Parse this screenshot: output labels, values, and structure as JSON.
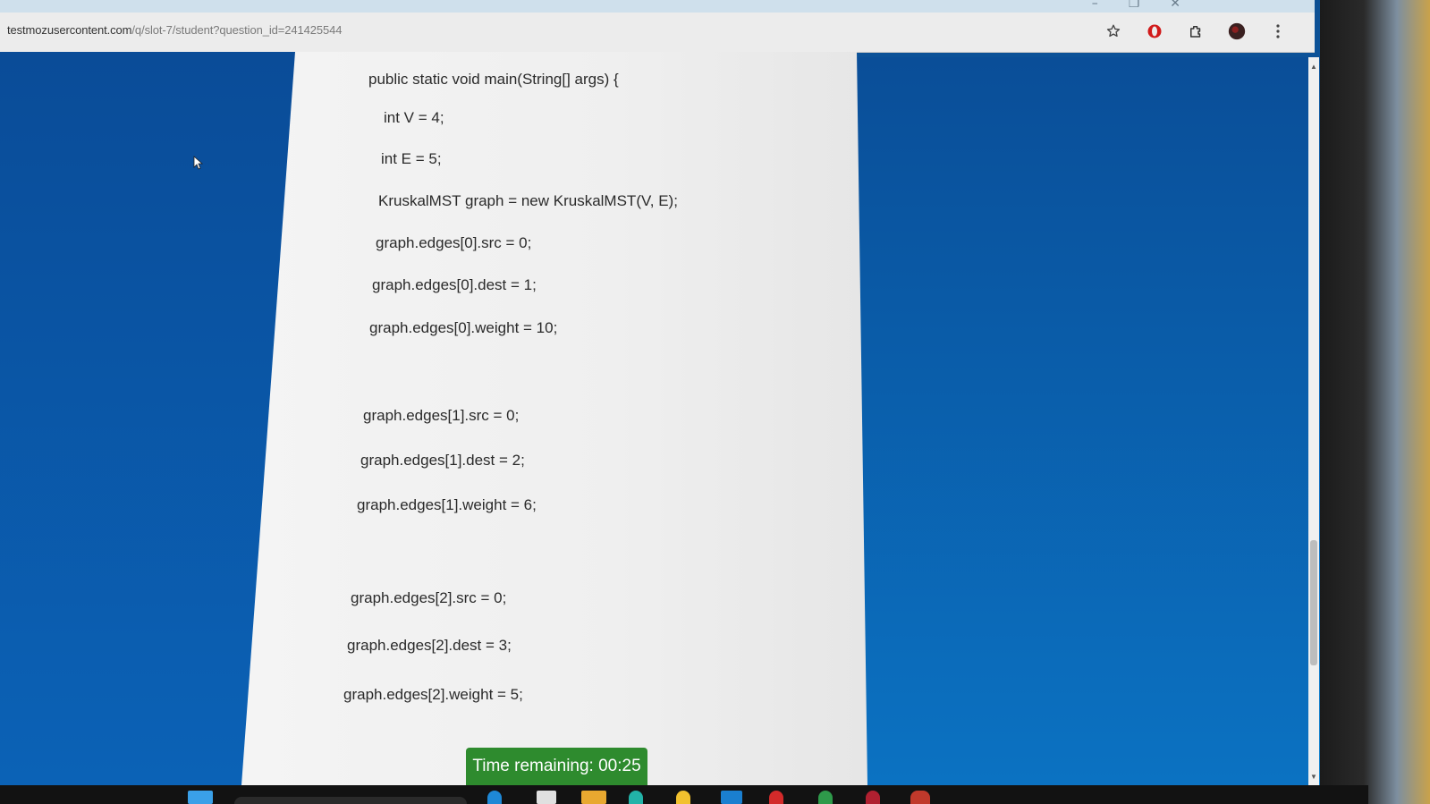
{
  "browser": {
    "url_host": "testmozusercontent.com",
    "url_path": "/q/slot-7/student?question_id=241425544",
    "icons": [
      "bookmark-star-icon",
      "opera-icon",
      "extensions-icon",
      "profile-avatar-icon",
      "menu-kebab-icon"
    ]
  },
  "code": {
    "lines": [
      "public static void main(String[] args) {",
      "int V = 4;",
      "int E = 5;",
      "KruskalMST graph = new KruskalMST(V, E);",
      "graph.edges[0].src = 0;",
      "graph.edges[0].dest = 1;",
      "graph.edges[0].weight = 10;",
      "graph.edges[1].src = 0;",
      "graph.edges[1].dest = 2;",
      "graph.edges[1].weight = 6;",
      "graph.edges[2].src = 0;",
      "graph.edges[2].dest = 3;",
      "graph.edges[2].weight = 5;"
    ]
  },
  "timer": {
    "label": "Time remaining: 00:25"
  },
  "colors": {
    "side_panel": "#0b62b6",
    "timer_bg": "#2e8b2e",
    "content_bg": "#f0f0f0"
  }
}
